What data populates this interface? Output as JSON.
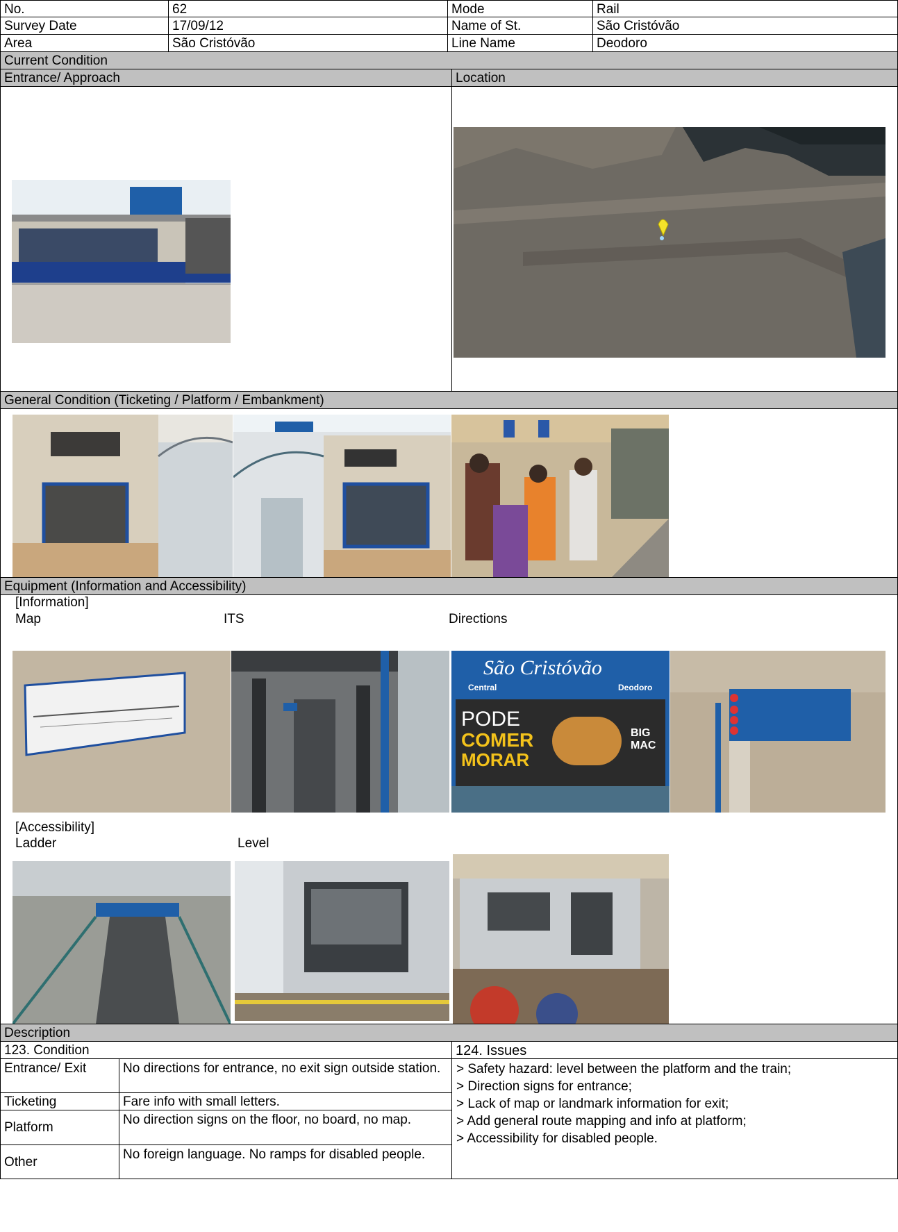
{
  "header": {
    "no_label": "No.",
    "no_value": "62",
    "mode_label": "Mode",
    "mode_value": "Rail",
    "date_label": "Survey Date",
    "date_value": "17/09/12",
    "station_label": "Name of St.",
    "station_value": "São Cristóvão",
    "area_label": "Area",
    "area_value": "São Cristóvão",
    "line_label": "Line Name",
    "line_value": "Deodoro"
  },
  "sections": {
    "current_condition": "Current Condition",
    "entrance_approach": "Entrance/ Approach",
    "location": "Location",
    "general_condition": "General Condition (Ticketing / Platform / Embankment)",
    "equipment": "Equipment (Information and Accessibility)",
    "information": "[Information]",
    "map": "Map",
    "its": "ITS",
    "directions": "Directions",
    "accessibility": "[Accessibility]",
    "ladder": "Ladder",
    "level": "Level",
    "description": "Description"
  },
  "photos": {
    "sign_title": "São Cristóvão",
    "sign_left": "Central",
    "sign_right": "Deodoro",
    "ad_line1": "PODE",
    "ad_line2": "COMER",
    "ad_line3": "MORAR",
    "ad_big": "BIG",
    "ad_mac": "MAC"
  },
  "description": {
    "condition_header": "123.      Condition",
    "issues_header": "124.      Issues",
    "rows": [
      {
        "label": "Entrance/ Exit",
        "text": "No directions for entrance, no exit sign outside station."
      },
      {
        "label": "Ticketing",
        "text": "Fare info with small letters."
      },
      {
        "label": "Platform",
        "text": "No direction signs on the floor, no board, no map."
      },
      {
        "label": "Other",
        "text": "No foreign language. No ramps for disabled people."
      }
    ],
    "issues": [
      "> Safety hazard: level between the platform and the train;",
      "> Direction signs for entrance;",
      "> Lack of map or landmark information for exit;",
      "> Add general route mapping and info at platform;",
      "> Accessibility for disabled people."
    ]
  },
  "colors": {
    "header_gray": "#c0c0c0",
    "sign_blue": "#1f5fa8"
  }
}
